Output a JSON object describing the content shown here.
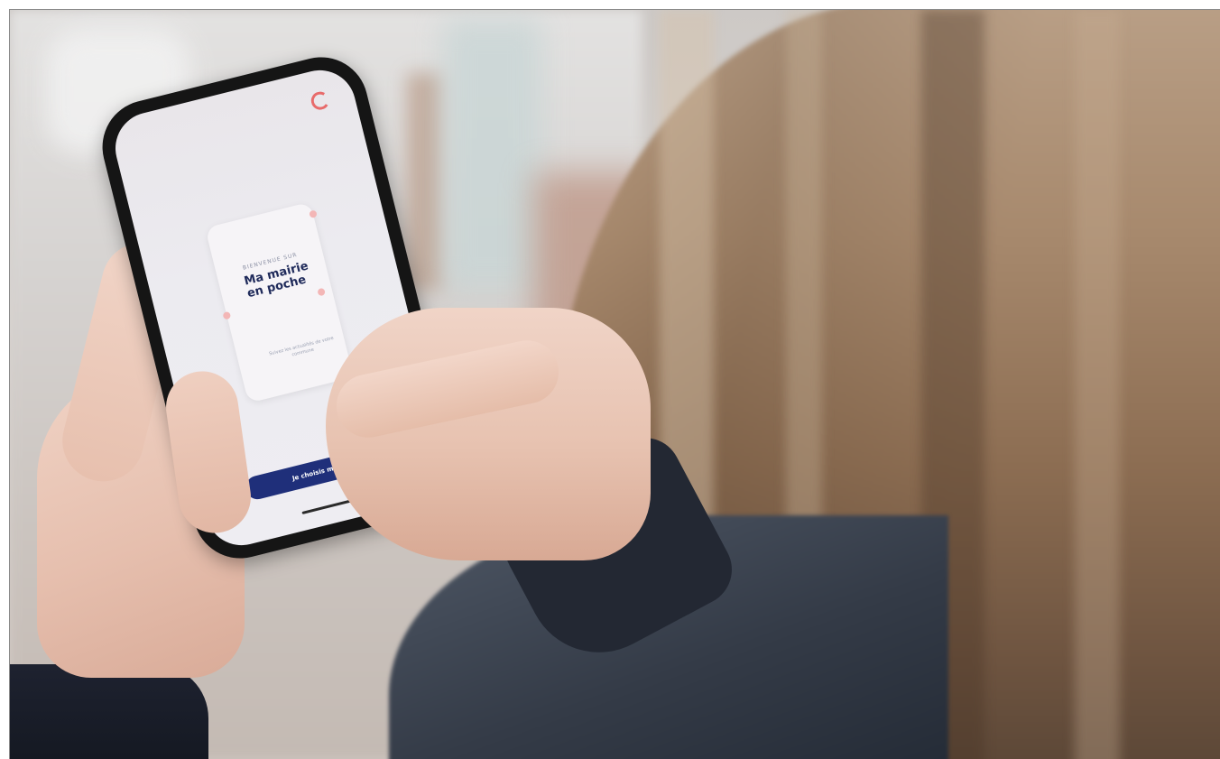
{
  "photo": {
    "description_tag": "person-holding-phone"
  },
  "phone_screen": {
    "card_pretitle": "BIENVENUE SUR",
    "card_title": "Ma mairie en poche",
    "card_body": "Suivez les actualités de votre commune",
    "cta_label": "Je choisis ma ville"
  },
  "colors": {
    "accent": "#1f2f7a",
    "logo": "#e86b6b"
  }
}
